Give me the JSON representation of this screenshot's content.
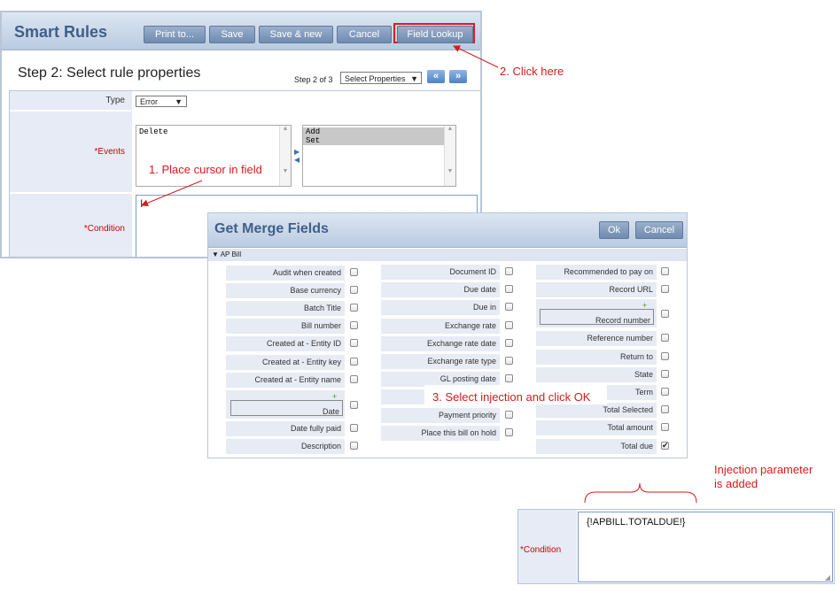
{
  "smart_rules": {
    "title": "Smart Rules",
    "buttons": {
      "print": "Print to...",
      "save": "Save",
      "save_new": "Save & new",
      "cancel": "Cancel",
      "field_lookup": "Field Lookup"
    },
    "step_title": "Step 2: Select rule properties",
    "step_of": "Step 2 of 3",
    "step_select": "Select Properties",
    "nav_prev": "«",
    "nav_next": "»",
    "type_label": "Type",
    "type_value": "Error",
    "events_label": "*Events",
    "events_available": [
      "Delete"
    ],
    "events_selected": [
      "Add",
      "Set"
    ],
    "condition_label": "*Condition"
  },
  "annotations": {
    "step1": "1. Place cursor in field",
    "step2": "2. Click here",
    "step3": "3. Select injection and click OK",
    "result_note_line1": "Injection parameter",
    "result_note_line2": "is added"
  },
  "merge_fields": {
    "title": "Get Merge Fields",
    "ok": "Ok",
    "cancel": "Cancel",
    "section": "AP Bill",
    "col1": [
      "Audit when created",
      "Base currency",
      "Batch Title",
      "Bill number",
      "Created at - Entity ID",
      "Created at - Entity key",
      "Created at - Entity name",
      "Date",
      "Date fully paid",
      "Description"
    ],
    "col2": [
      "Document ID",
      "Due date",
      "Due in",
      "Exchange rate",
      "Exchange rate date",
      "Exchange rate type",
      "GL posting date",
      "",
      "Payment priority",
      "Place this bill on hold"
    ],
    "col3": [
      "Recommended to pay on",
      "Record URL",
      "Record number",
      "Reference number",
      "Return to",
      "State",
      "Term",
      "Total Selected",
      "Total amount",
      "Total due"
    ],
    "checked_field": "Total due"
  },
  "result": {
    "condition_label": "*Condition",
    "condition_value": "{!APBILL.TOTALDUE!}"
  },
  "colors": {
    "annotation": "#d81a1a",
    "header_text": "#3f5f8a",
    "required": "#d20000"
  }
}
